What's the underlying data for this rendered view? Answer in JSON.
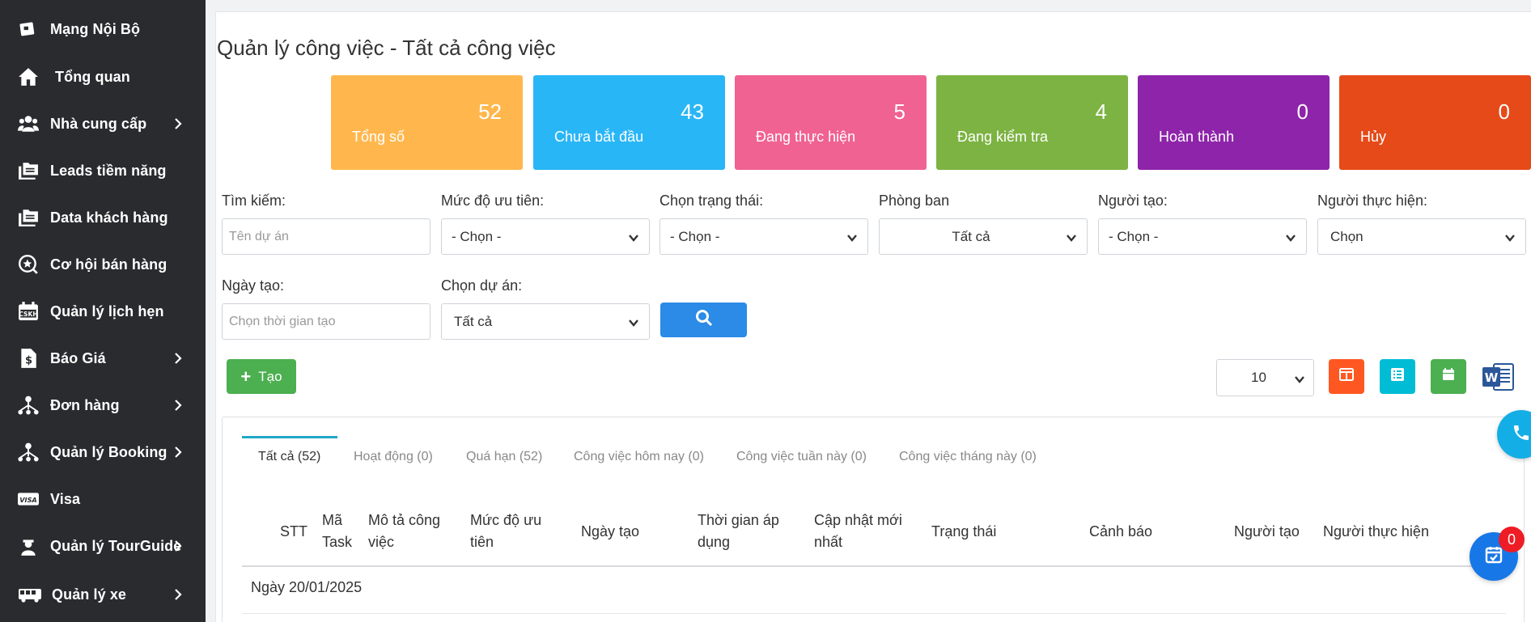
{
  "sidebar": {
    "items": [
      {
        "label": "Mạng Nội Bộ",
        "icon": "network-icon",
        "chevron": false
      },
      {
        "label": "Tổng quan",
        "icon": "home-icon",
        "chevron": false
      },
      {
        "label": "Nhà cung cấp",
        "icon": "users-icon",
        "chevron": true
      },
      {
        "label": "Leads tiềm năng",
        "icon": "folders-icon",
        "chevron": false
      },
      {
        "label": "Data khách hàng",
        "icon": "folders-icon",
        "chevron": false
      },
      {
        "label": "Cơ hội bán hàng",
        "icon": "star-circle-icon",
        "chevron": false
      },
      {
        "label": "Quản lý lịch hẹn",
        "icon": "calendar-cskh-icon",
        "chevron": false
      },
      {
        "label": "Báo Giá",
        "icon": "dollar-file-icon",
        "chevron": true
      },
      {
        "label": "Đơn hàng",
        "icon": "sitemap-icon",
        "chevron": true
      },
      {
        "label": "Quản lý Booking",
        "icon": "sitemap-icon",
        "chevron": true
      },
      {
        "label": "Visa",
        "icon": "visa-card-icon",
        "chevron": false
      },
      {
        "label": "Quản lý TourGuide",
        "icon": "guide-person-icon",
        "chevron": true
      },
      {
        "label": "Quản lý xe",
        "icon": "bus-icon",
        "chevron": true
      }
    ]
  },
  "page_title": "Quản lý công việc - Tất cả công việc",
  "stats": [
    {
      "value": "52",
      "label": "Tổng số",
      "color": "#ffb74d"
    },
    {
      "value": "43",
      "label": "Chưa bắt đầu",
      "color": "#29b6f6"
    },
    {
      "value": "5",
      "label": "Đang thực hiện",
      "color": "#f06292"
    },
    {
      "value": "4",
      "label": "Đang kiểm tra",
      "color": "#7cb342"
    },
    {
      "value": "0",
      "label": "Hoàn thành",
      "color": "#8e24aa"
    },
    {
      "value": "0",
      "label": "Hủy",
      "color": "#e64a19"
    }
  ],
  "filters": {
    "search": {
      "label": "Tìm kiếm:",
      "placeholder": "Tên dự án"
    },
    "priority": {
      "label": "Mức độ ưu tiên:",
      "value": "- Chọn -"
    },
    "status": {
      "label": "Chọn trạng thái:",
      "value": "- Chọn -"
    },
    "department": {
      "label": "Phòng ban",
      "value": "Tất cả"
    },
    "creator": {
      "label": "Người tạo:",
      "value": "- Chọn -"
    },
    "assignee": {
      "label": "Người thực hiện:",
      "value": "Chọn"
    },
    "created_date": {
      "label": "Ngày tạo:",
      "placeholder": "Chọn thời gian tạo"
    },
    "project": {
      "label": "Chọn dự án:",
      "value": "Tất cả"
    }
  },
  "toolbar": {
    "create_label": "Tạo",
    "per_page": "10"
  },
  "tabs": [
    {
      "label": "Tất cả (52)",
      "active": true
    },
    {
      "label": "Hoạt động (0)",
      "active": false
    },
    {
      "label": "Quá hạn (52)",
      "active": false
    },
    {
      "label": "Công việc hôm nay (0)",
      "active": false
    },
    {
      "label": "Công việc tuần này (0)",
      "active": false
    },
    {
      "label": "Công việc tháng này (0)",
      "active": false
    }
  ],
  "table": {
    "headers": {
      "stt": "STT",
      "task_code_1": "Mã",
      "task_code_2": "Task",
      "desc_1": "Mô tả công",
      "desc_2": "việc",
      "priority_1": "Mức độ ưu",
      "priority_2": "tiên",
      "created": "Ngày tạo",
      "apply_1": "Thời gian áp",
      "apply_2": "dụng",
      "updated_1": "Cập nhật mới",
      "updated_2": "nhất",
      "status": "Trạng thái",
      "warning": "Cảnh báo",
      "creator": "Người tạo",
      "assignee": "Người thực hiện"
    },
    "group_label": "Ngày 20/01/2025"
  },
  "floating": {
    "badge_count": "0"
  }
}
